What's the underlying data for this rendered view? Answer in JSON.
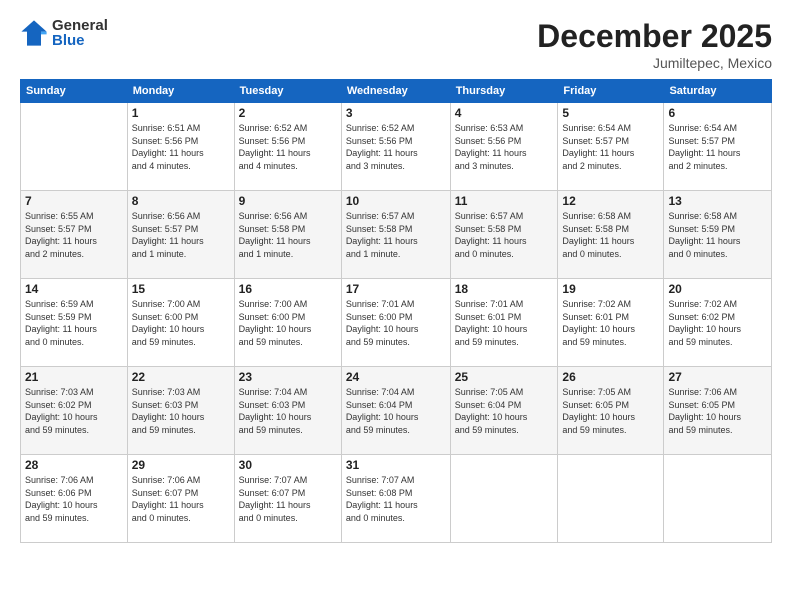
{
  "logo": {
    "general": "General",
    "blue": "Blue"
  },
  "header": {
    "month": "December 2025",
    "location": "Jumiltepec, Mexico"
  },
  "days_of_week": [
    "Sunday",
    "Monday",
    "Tuesday",
    "Wednesday",
    "Thursday",
    "Friday",
    "Saturday"
  ],
  "weeks": [
    [
      {
        "day": "",
        "info": ""
      },
      {
        "day": "1",
        "info": "Sunrise: 6:51 AM\nSunset: 5:56 PM\nDaylight: 11 hours\nand 4 minutes."
      },
      {
        "day": "2",
        "info": "Sunrise: 6:52 AM\nSunset: 5:56 PM\nDaylight: 11 hours\nand 4 minutes."
      },
      {
        "day": "3",
        "info": "Sunrise: 6:52 AM\nSunset: 5:56 PM\nDaylight: 11 hours\nand 3 minutes."
      },
      {
        "day": "4",
        "info": "Sunrise: 6:53 AM\nSunset: 5:56 PM\nDaylight: 11 hours\nand 3 minutes."
      },
      {
        "day": "5",
        "info": "Sunrise: 6:54 AM\nSunset: 5:57 PM\nDaylight: 11 hours\nand 2 minutes."
      },
      {
        "day": "6",
        "info": "Sunrise: 6:54 AM\nSunset: 5:57 PM\nDaylight: 11 hours\nand 2 minutes."
      }
    ],
    [
      {
        "day": "7",
        "info": "Sunrise: 6:55 AM\nSunset: 5:57 PM\nDaylight: 11 hours\nand 2 minutes."
      },
      {
        "day": "8",
        "info": "Sunrise: 6:56 AM\nSunset: 5:57 PM\nDaylight: 11 hours\nand 1 minute."
      },
      {
        "day": "9",
        "info": "Sunrise: 6:56 AM\nSunset: 5:58 PM\nDaylight: 11 hours\nand 1 minute."
      },
      {
        "day": "10",
        "info": "Sunrise: 6:57 AM\nSunset: 5:58 PM\nDaylight: 11 hours\nand 1 minute."
      },
      {
        "day": "11",
        "info": "Sunrise: 6:57 AM\nSunset: 5:58 PM\nDaylight: 11 hours\nand 0 minutes."
      },
      {
        "day": "12",
        "info": "Sunrise: 6:58 AM\nSunset: 5:58 PM\nDaylight: 11 hours\nand 0 minutes."
      },
      {
        "day": "13",
        "info": "Sunrise: 6:58 AM\nSunset: 5:59 PM\nDaylight: 11 hours\nand 0 minutes."
      }
    ],
    [
      {
        "day": "14",
        "info": "Sunrise: 6:59 AM\nSunset: 5:59 PM\nDaylight: 11 hours\nand 0 minutes."
      },
      {
        "day": "15",
        "info": "Sunrise: 7:00 AM\nSunset: 6:00 PM\nDaylight: 10 hours\nand 59 minutes."
      },
      {
        "day": "16",
        "info": "Sunrise: 7:00 AM\nSunset: 6:00 PM\nDaylight: 10 hours\nand 59 minutes."
      },
      {
        "day": "17",
        "info": "Sunrise: 7:01 AM\nSunset: 6:00 PM\nDaylight: 10 hours\nand 59 minutes."
      },
      {
        "day": "18",
        "info": "Sunrise: 7:01 AM\nSunset: 6:01 PM\nDaylight: 10 hours\nand 59 minutes."
      },
      {
        "day": "19",
        "info": "Sunrise: 7:02 AM\nSunset: 6:01 PM\nDaylight: 10 hours\nand 59 minutes."
      },
      {
        "day": "20",
        "info": "Sunrise: 7:02 AM\nSunset: 6:02 PM\nDaylight: 10 hours\nand 59 minutes."
      }
    ],
    [
      {
        "day": "21",
        "info": "Sunrise: 7:03 AM\nSunset: 6:02 PM\nDaylight: 10 hours\nand 59 minutes."
      },
      {
        "day": "22",
        "info": "Sunrise: 7:03 AM\nSunset: 6:03 PM\nDaylight: 10 hours\nand 59 minutes."
      },
      {
        "day": "23",
        "info": "Sunrise: 7:04 AM\nSunset: 6:03 PM\nDaylight: 10 hours\nand 59 minutes."
      },
      {
        "day": "24",
        "info": "Sunrise: 7:04 AM\nSunset: 6:04 PM\nDaylight: 10 hours\nand 59 minutes."
      },
      {
        "day": "25",
        "info": "Sunrise: 7:05 AM\nSunset: 6:04 PM\nDaylight: 10 hours\nand 59 minutes."
      },
      {
        "day": "26",
        "info": "Sunrise: 7:05 AM\nSunset: 6:05 PM\nDaylight: 10 hours\nand 59 minutes."
      },
      {
        "day": "27",
        "info": "Sunrise: 7:06 AM\nSunset: 6:05 PM\nDaylight: 10 hours\nand 59 minutes."
      }
    ],
    [
      {
        "day": "28",
        "info": "Sunrise: 7:06 AM\nSunset: 6:06 PM\nDaylight: 10 hours\nand 59 minutes."
      },
      {
        "day": "29",
        "info": "Sunrise: 7:06 AM\nSunset: 6:07 PM\nDaylight: 11 hours\nand 0 minutes."
      },
      {
        "day": "30",
        "info": "Sunrise: 7:07 AM\nSunset: 6:07 PM\nDaylight: 11 hours\nand 0 minutes."
      },
      {
        "day": "31",
        "info": "Sunrise: 7:07 AM\nSunset: 6:08 PM\nDaylight: 11 hours\nand 0 minutes."
      },
      {
        "day": "",
        "info": ""
      },
      {
        "day": "",
        "info": ""
      },
      {
        "day": "",
        "info": ""
      }
    ]
  ]
}
